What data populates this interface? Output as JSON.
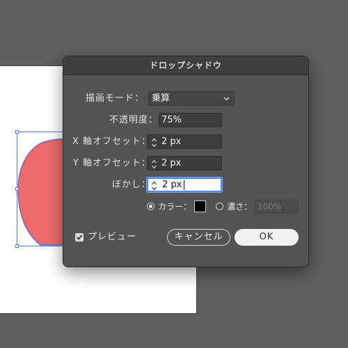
{
  "dialog": {
    "title": "ドロップシャドウ",
    "mode": {
      "label": "描画モード：",
      "value": "乗算"
    },
    "opacity": {
      "label": "不透明度：",
      "value": "75%"
    },
    "x_offset": {
      "label": "X 軸オフセット：",
      "value": "2 px"
    },
    "y_offset": {
      "label": "Y 軸オフセット：",
      "value": "2 px"
    },
    "blur": {
      "label": "ぼかし：",
      "value": "2 px"
    },
    "color_option": {
      "label": "カラー：",
      "selected": true,
      "swatch_color": "#000000"
    },
    "density_option": {
      "label": "濃さ：",
      "selected": false,
      "value": "100%"
    },
    "preview": {
      "label": "プレビュー",
      "checked": true
    },
    "buttons": {
      "cancel": "キャンセル",
      "ok": "OK"
    }
  },
  "colors": {
    "shape_fill": "#ee6b6b",
    "selection": "#4a7bd8",
    "dialog_bg": "#535353",
    "focus": "#4a86e8"
  }
}
